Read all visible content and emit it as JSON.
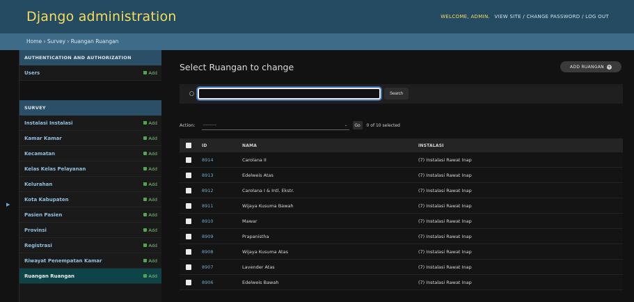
{
  "header": {
    "branding": "Django administration",
    "welcome": "WELCOME, ADMIN.",
    "tools": "VIEW SITE / CHANGE PASSWORD / LOG OUT"
  },
  "breadcrumbs": "Home › Survey › Ruangan Ruangan",
  "sidebar": {
    "auth_caption": "AUTHENTICATION AND AUTHORIZATION",
    "auth_items": [
      {
        "label": "Users",
        "add": "Add"
      }
    ],
    "survey_caption": "SURVEY",
    "survey_items": [
      {
        "label": "Instalasi Instalasi",
        "add": "Add"
      },
      {
        "label": "Kamar Kamar",
        "add": "Add"
      },
      {
        "label": "Kecamatan",
        "add": "Add"
      },
      {
        "label": "Kelas Kelas Pelayanan",
        "add": "Add"
      },
      {
        "label": "Kelurahan",
        "add": "Add"
      },
      {
        "label": "Kota Kabupaten",
        "add": "Add"
      },
      {
        "label": "Pasien Pasien",
        "add": "Add"
      },
      {
        "label": "Provinsi",
        "add": "Add"
      },
      {
        "label": "Registrasi",
        "add": "Add"
      },
      {
        "label": "Riwayat Penempatan Kamar",
        "add": "Add"
      },
      {
        "label": "Ruangan Ruangan",
        "add": "Add"
      }
    ]
  },
  "main": {
    "title": "Select Ruangan to change",
    "add_button": "ADD RUANGAN",
    "search_button": "Search",
    "search_value": "",
    "action_label": "Action:",
    "action_default": "---------",
    "go_button": "Go",
    "selected_count": "0 of 10 selected",
    "columns": [
      "ID",
      "NAMA",
      "INSTALASI"
    ],
    "rows": [
      {
        "id": "8914",
        "nama": "Carolana II",
        "instalasi": "(7) Instalasi Rawat Inap"
      },
      {
        "id": "8913",
        "nama": "Edelweis Atas",
        "instalasi": "(7) Instalasi Rawat Inap"
      },
      {
        "id": "8912",
        "nama": "Carolana I & Intl. Ekstr.",
        "instalasi": "(7) Instalasi Rawat Inap"
      },
      {
        "id": "8911",
        "nama": "Wijaya Kusuma Bawah",
        "instalasi": "(7) Instalasi Rawat Inap"
      },
      {
        "id": "8910",
        "nama": "Mawar",
        "instalasi": "(7) Instalasi Rawat Inap"
      },
      {
        "id": "8909",
        "nama": "Prapanistha",
        "instalasi": "(7) Instalasi Rawat Inap"
      },
      {
        "id": "8908",
        "nama": "Wijaya Kusuma Atas",
        "instalasi": "(7) Instalasi Rawat Inap"
      },
      {
        "id": "8907",
        "nama": "Lavender Atas",
        "instalasi": "(7) Instalasi Rawat Inap"
      },
      {
        "id": "8906",
        "nama": "Edelweis Bawah",
        "instalasi": "(7) Instalasi Rawat Inap"
      }
    ]
  }
}
